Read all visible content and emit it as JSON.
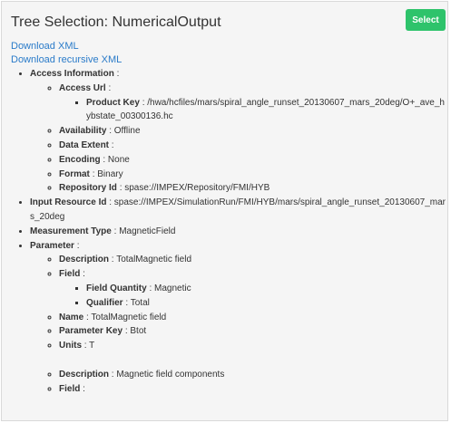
{
  "title": "Tree Selection: NumericalOutput",
  "select_label": "Select",
  "links": {
    "download_xml": "Download XML",
    "download_recursive": "Download recursive XML"
  },
  "sep": ":",
  "tree": {
    "access_info": "Access Information",
    "access_url": "Access Url",
    "product_key": "Product Key",
    "product_key_value": "/hwa/hcfiles/mars/spiral_angle_runset_20130607_mars_20deg/O+_ave_hybstate_00300136.hc",
    "availability": "Availability",
    "availability_value": "Offline",
    "data_extent": "Data Extent",
    "encoding": "Encoding",
    "encoding_value": "None",
    "format": "Format",
    "format_value": "Binary",
    "repository_id": "Repository Id",
    "repository_id_value": "spase://IMPEX/Repository/FMI/HYB",
    "input_resource_id": "Input Resource Id",
    "input_resource_id_value": "spase://IMPEX/SimulationRun/FMI/HYB/mars/spiral_angle_runset_20130607_mars_20deg",
    "measurement_type": "Measurement Type",
    "measurement_type_value": "MagneticField",
    "parameter": "Parameter",
    "p1": {
      "description": "Description",
      "description_value": "TotalMagnetic field",
      "field": "Field",
      "field_quantity": "Field Quantity",
      "field_quantity_value": "Magnetic",
      "qualifier": "Qualifier",
      "qualifier_value": "Total",
      "name": "Name",
      "name_value": "TotalMagnetic field",
      "parameter_key": "Parameter Key",
      "parameter_key_value": "Btot",
      "units": "Units",
      "units_value": "T"
    },
    "p2": {
      "description": "Description",
      "description_value": "Magnetic field components",
      "field": "Field"
    }
  }
}
